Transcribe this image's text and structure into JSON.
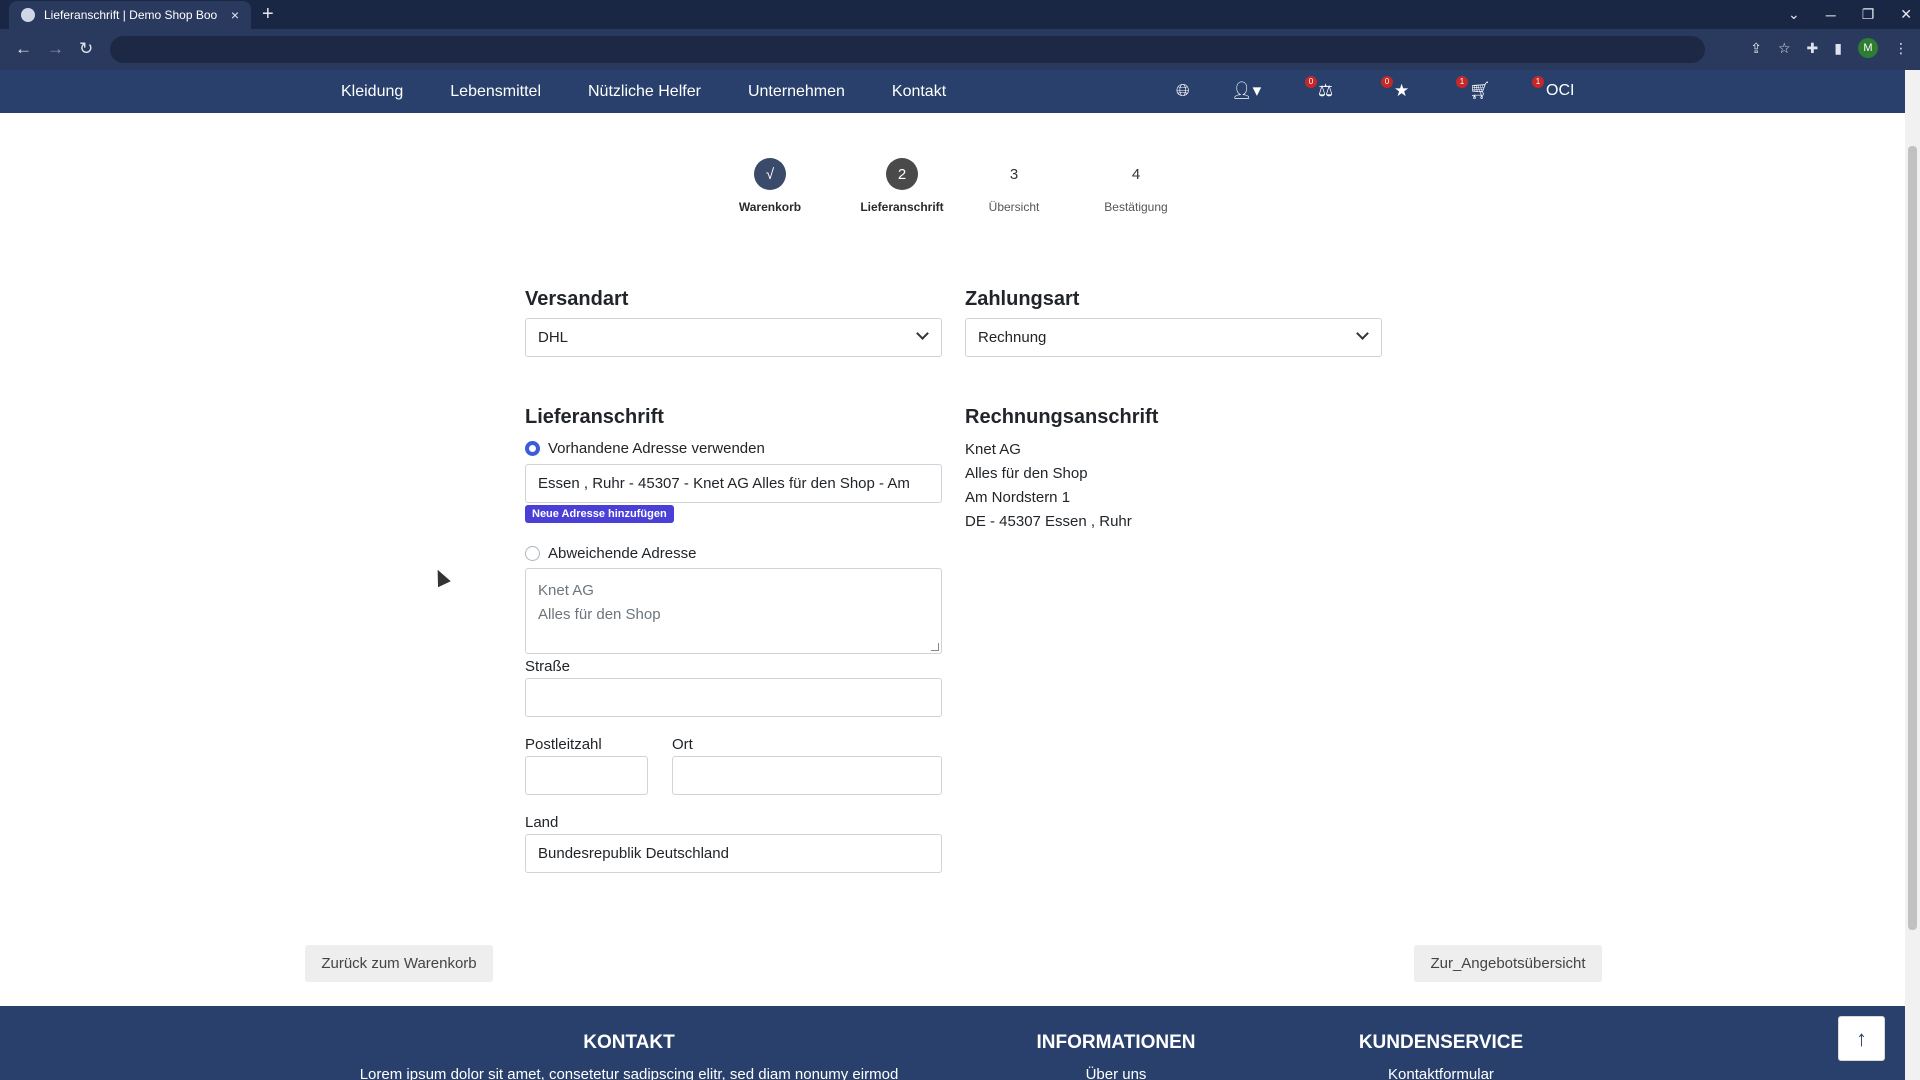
{
  "browser": {
    "tab_title": "Lieferanschrift | Demo Shop Boo",
    "tab_close": "×",
    "new_tab": "+",
    "profile_initial": "M"
  },
  "nav": {
    "menu": [
      "Kleidung",
      "Lebensmittel",
      "Nützliche Helfer",
      "Unternehmen",
      "Kontakt"
    ],
    "compare_count": "0",
    "wishlist_count": "0",
    "cart_count": "1",
    "oci_count": "1",
    "oci_label": "OCI"
  },
  "steps": [
    {
      "symbol": "√",
      "label": "Warenkorb",
      "state": "done"
    },
    {
      "symbol": "2",
      "label": "Lieferanschrift",
      "state": "active"
    },
    {
      "symbol": "3",
      "label": "Übersicht",
      "state": "pending"
    },
    {
      "symbol": "4",
      "label": "Bestätigung",
      "state": "pending"
    }
  ],
  "shipping": {
    "heading": "Versandart",
    "value": "DHL"
  },
  "payment": {
    "heading": "Zahlungsart",
    "value": "Rechnung"
  },
  "delivery": {
    "heading": "Lieferanschrift",
    "existing_label": "Vorhandene Adresse verwenden",
    "existing_value": "Essen , Ruhr - 45307 - Knet AG Alles für den Shop - Am",
    "new_address_button": "Neue Adresse hinzufügen",
    "different_label": "Abweichende Adresse",
    "company_lines": [
      "Knet AG",
      "Alles für den Shop"
    ],
    "street_label": "Straße",
    "zip_label": "Postleitzahl",
    "city_label": "Ort",
    "country_label": "Land",
    "country_value": "Bundesrepublik Deutschland"
  },
  "billing": {
    "heading": "Rechnungsanschrift",
    "lines": [
      "Knet AG",
      "Alles für den Shop",
      "Am Nordstern 1",
      "DE - 45307 Essen , Ruhr"
    ]
  },
  "actions": {
    "back": "Zurück zum Warenkorb",
    "next": "Zur_Angebotsübersicht"
  },
  "footer": {
    "col1_title": "KONTAKT",
    "col1_text": "Lorem ipsum dolor sit amet, consetetur sadipscing elitr, sed diam nonumy eirmod",
    "col2_title": "INFORMATIONEN",
    "col2_text": "Über uns",
    "col3_title": "KUNDENSERVICE",
    "col3_text": "Kontaktformular"
  },
  "colors": {
    "nav_bg": "#28406b",
    "accent": "#4a3fd6",
    "radio": "#3b5bdb",
    "badge": "#c62828"
  }
}
